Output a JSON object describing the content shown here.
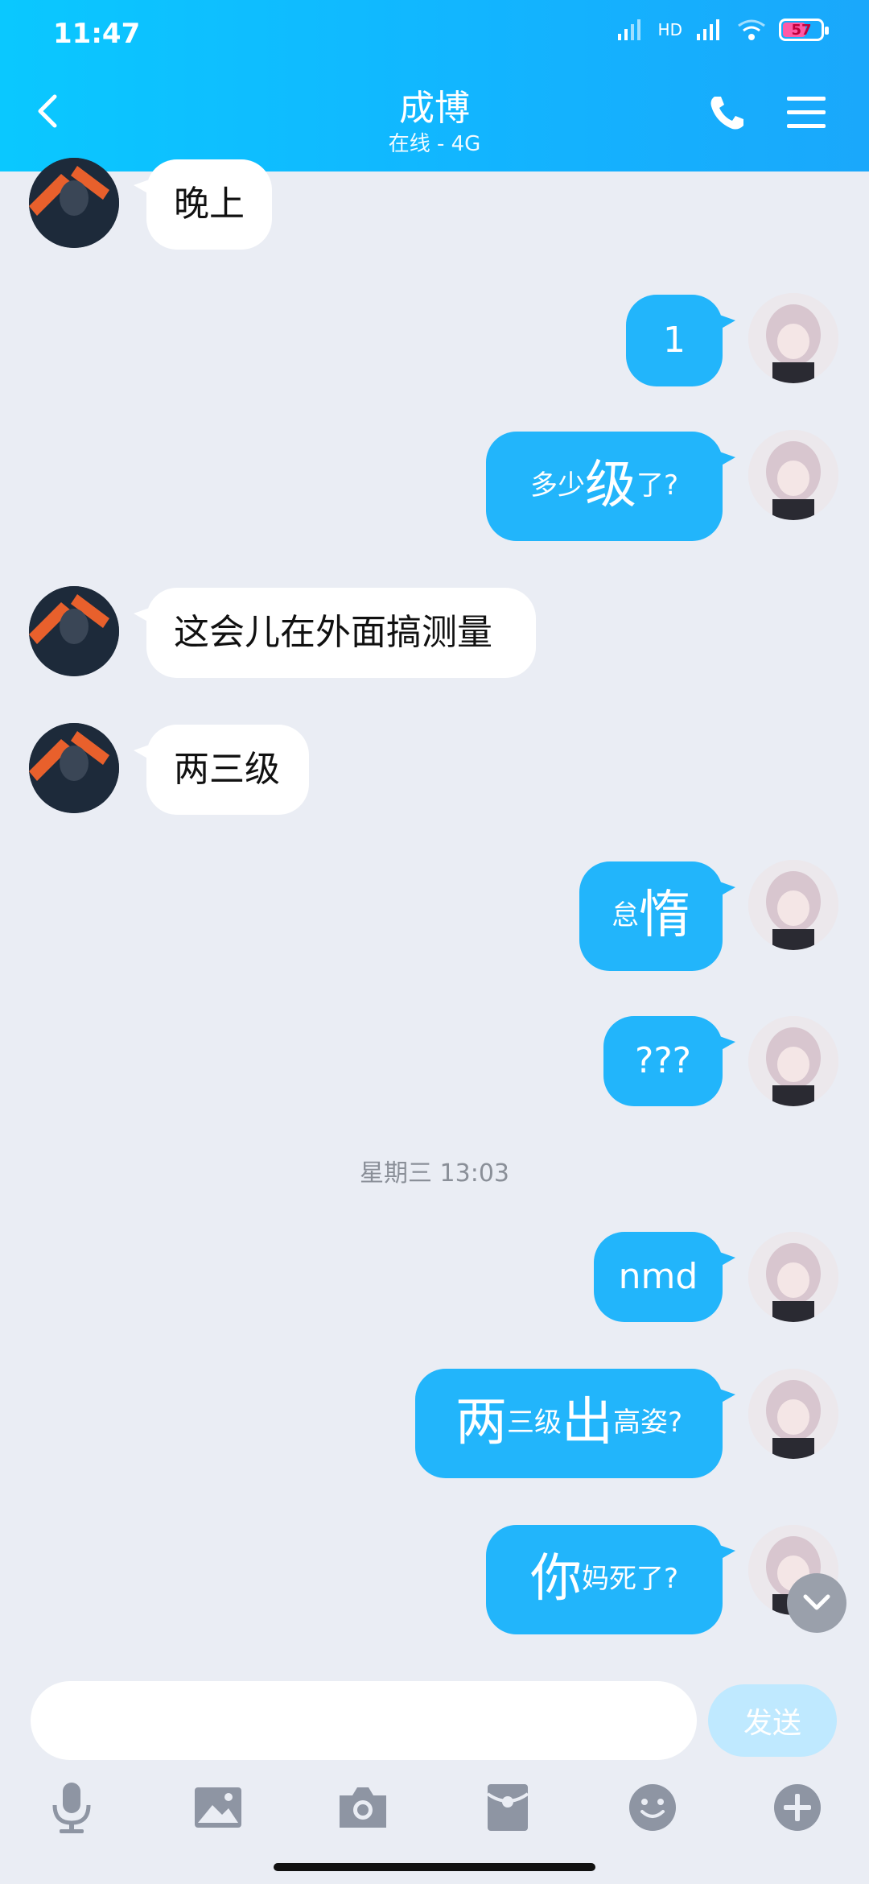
{
  "status_bar": {
    "time": "11:47",
    "network_label": "HD",
    "battery_level": "57"
  },
  "header": {
    "title": "成博",
    "subtitle": "在线 - 4G"
  },
  "messages": [
    {
      "side": "in",
      "text": "晚上"
    },
    {
      "side": "out",
      "text": "1"
    },
    {
      "side": "out",
      "parts": [
        "多少",
        "级",
        "了?"
      ]
    },
    {
      "side": "in",
      "text": "这会儿在外面搞测量"
    },
    {
      "side": "in",
      "text": "两三级"
    },
    {
      "side": "out",
      "parts": [
        "怠",
        "惰"
      ]
    },
    {
      "side": "out",
      "text": "???"
    },
    {
      "side": "out",
      "text": "nmd"
    },
    {
      "side": "out",
      "parts": [
        "两",
        "三级",
        "出",
        "高姿?"
      ]
    },
    {
      "side": "out",
      "parts": [
        "你",
        "妈死了?"
      ]
    }
  ],
  "timestamp": "星期三 13:03",
  "input": {
    "value": "",
    "send_label": "发送"
  },
  "icons": [
    "back-icon",
    "phone-icon",
    "menu-icon",
    "microphone-icon",
    "image-icon",
    "camera-icon",
    "red-packet-icon",
    "emoji-icon",
    "plus-icon",
    "chevron-down-icon"
  ]
}
